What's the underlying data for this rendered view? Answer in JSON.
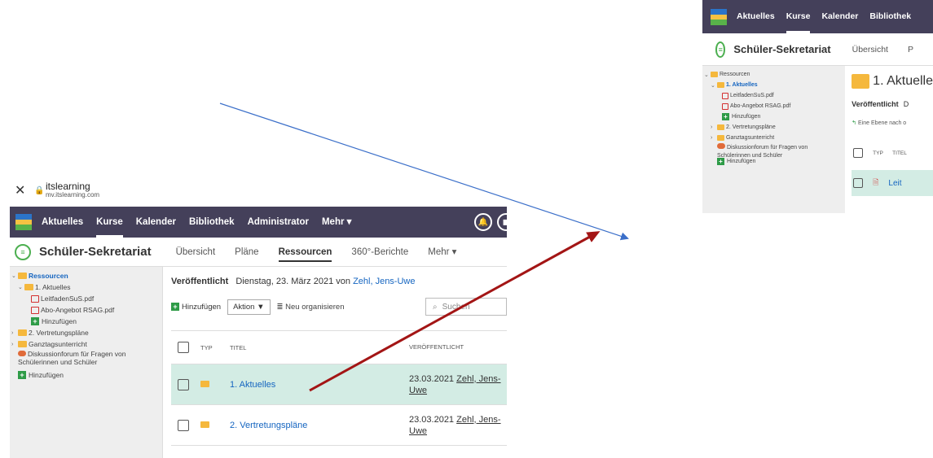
{
  "left": {
    "browser": {
      "close_icon": "close-icon",
      "lock_icon": "lock-icon",
      "site_title": "itslearning",
      "site_url": "mv.itslearning.com"
    },
    "topnav": {
      "items": [
        "Aktuelles",
        "Kurse",
        "Kalender",
        "Bibliothek",
        "Administrator",
        "Mehr ▾"
      ],
      "active_index": 1
    },
    "course": {
      "title": "Schüler-Sekretariat",
      "tabs": [
        "Übersicht",
        "Pläne",
        "Ressourcen",
        "360°-Berichte",
        "Mehr ▾"
      ],
      "active_tab": "Ressourcen"
    },
    "sidebar": {
      "root": "Ressourcen",
      "aktuelles": "1. Aktuelles",
      "file1": "LeitfadenSuS.pdf",
      "file2": "Abo-Angebot RSAG.pdf",
      "add_inner": "Hinzufügen",
      "vertretung": "2. Vertretungspläne",
      "ganztag": "Ganztagsunterricht",
      "forum": "Diskussionforum für Fragen von Schülerinnen und Schüler",
      "add_outer": "Hinzufügen"
    },
    "main": {
      "published_label": "Veröffentlicht",
      "published_text": "Dienstag, 23. März 2021 von",
      "published_author": "Zehl, Jens-Uwe",
      "add_label": "Hinzufügen",
      "action_label": "Aktion ▼",
      "reorganize_label": "Neu organisieren",
      "search_placeholder": "Suchen",
      "col_typ": "TYP",
      "col_title": "TITEL",
      "col_published": "VERÖFFENTLICHT",
      "rows": [
        {
          "title": "1. Aktuelles",
          "date": "23.03.2021",
          "author": "Zehl, Jens-",
          "author2": "Uwe"
        },
        {
          "title": "2. Vertretungspläne",
          "date": "23.03.2021",
          "author": "Zehl, Jens-",
          "author2": "Uwe"
        }
      ]
    }
  },
  "right": {
    "topnav": {
      "items": [
        "Aktuelles",
        "Kurse",
        "Kalender",
        "Bibliothek"
      ],
      "active_index": 1
    },
    "course": {
      "title": "Schüler-Sekretariat",
      "tabs": [
        "Übersicht",
        "P"
      ]
    },
    "sidebar": {
      "root": "Ressourcen",
      "aktuelles": "1. Aktuelles",
      "file1": "LeitfadenSuS.pdf",
      "file2": "Abo-Angebot RSAG.pdf",
      "add_inner": "Hinzufügen",
      "vertretung": "2. Vertretungspläne",
      "ganztag": "Ganztagsunterricht",
      "forum": "Diskussionforum für Fragen von Schülerinnen und Schüler",
      "add_outer": "Hinzufügen"
    },
    "main": {
      "heading": "1. Aktuelle",
      "published_label": "Veröffentlicht",
      "published_text": "D",
      "level_up": "Eine Ebene nach o",
      "col_typ": "TYP",
      "col_title": "TITEL",
      "row_title": "Leit"
    }
  },
  "colors": {
    "nav_bg": "#44405a",
    "selected_row": "#d3ece4",
    "link": "#1565c0",
    "blue_arrow": "#3b6fc9",
    "red_arrow": "#a31515"
  }
}
